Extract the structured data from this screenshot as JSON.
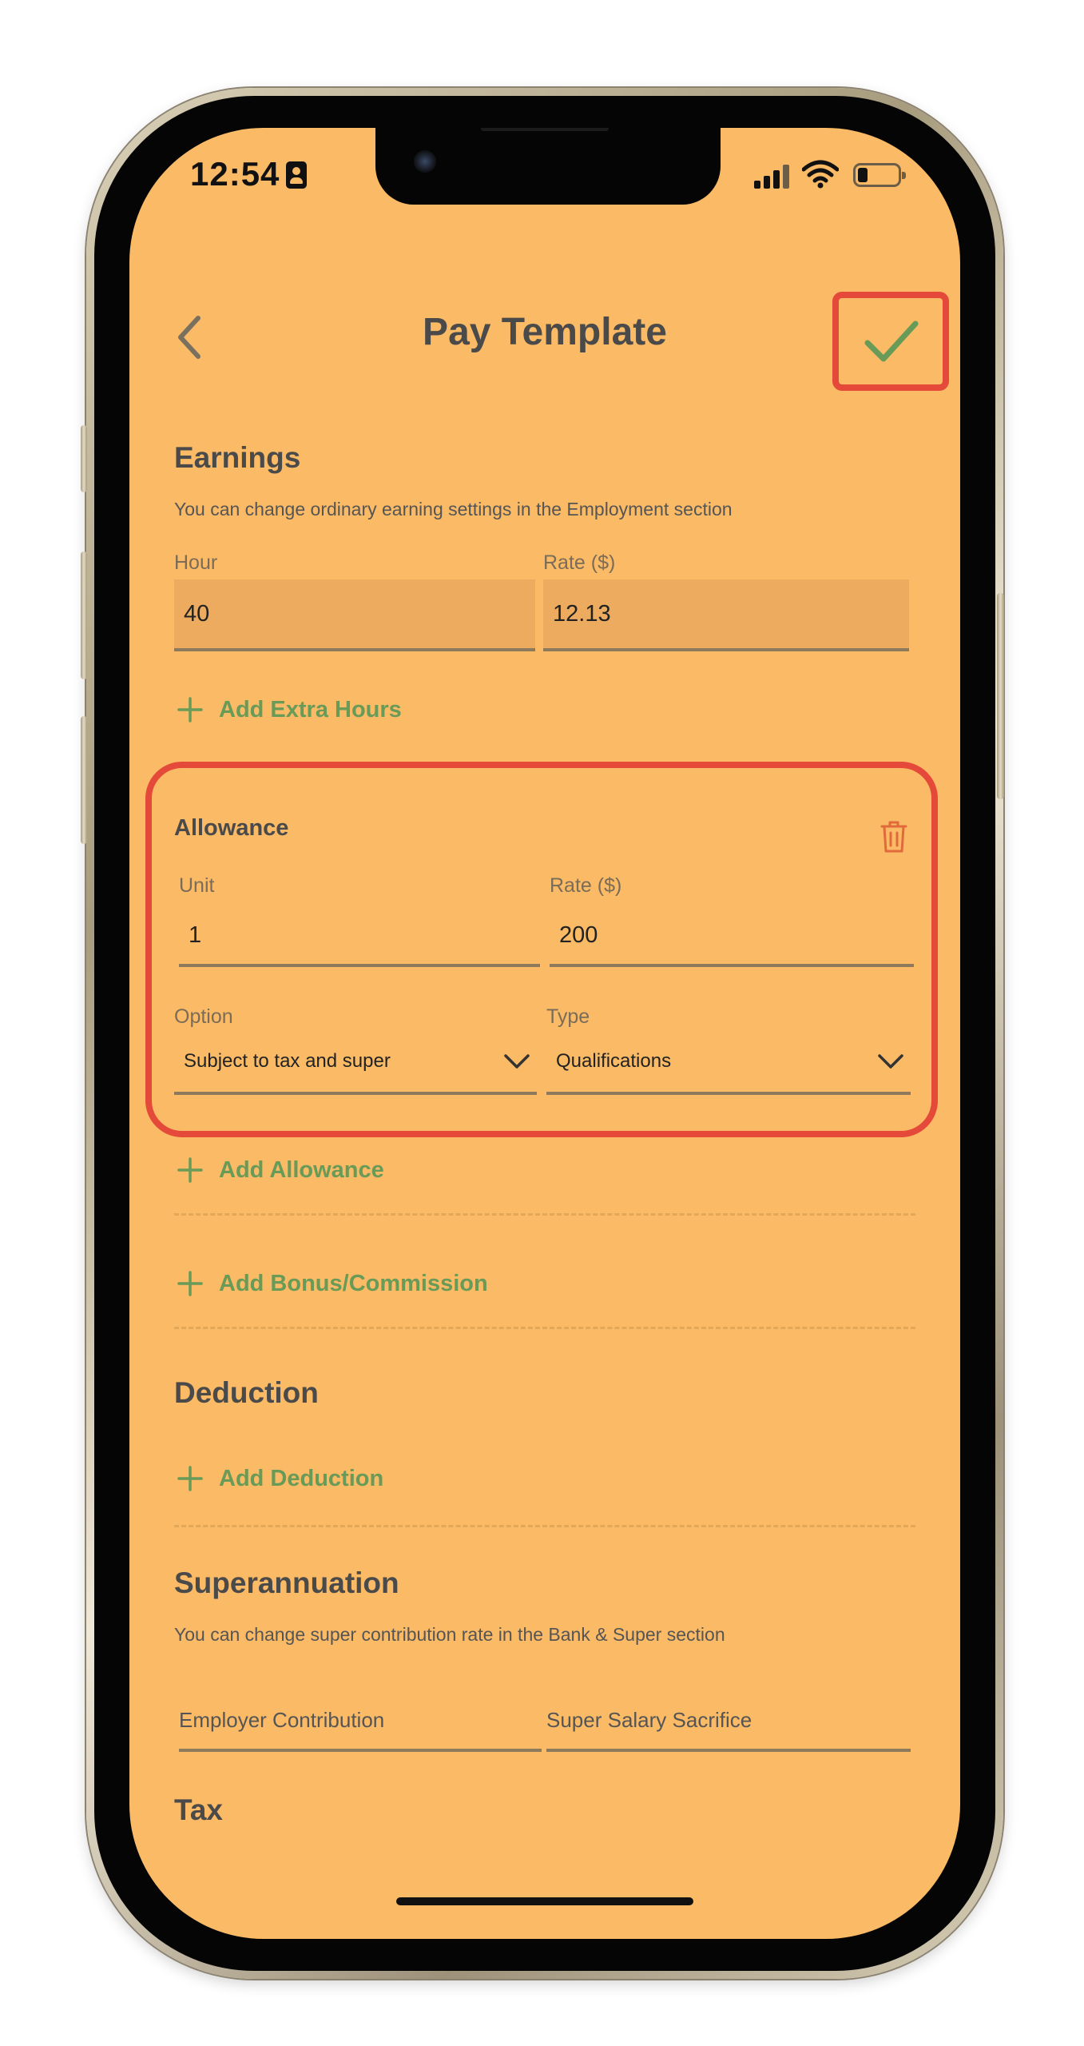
{
  "status_bar": {
    "time": "12:54"
  },
  "nav": {
    "title": "Pay Template"
  },
  "earnings": {
    "title": "Earnings",
    "hint": "You can change ordinary earning settings in the Employment section",
    "hour_label": "Hour",
    "hour_value": "40",
    "rate_label": "Rate ($)",
    "rate_value": "12.13",
    "add_extra_hours": "Add Extra Hours"
  },
  "allowance": {
    "title": "Allowance",
    "unit_label": "Unit",
    "unit_value": "1",
    "rate_label": "Rate ($)",
    "rate_value": "200",
    "option_label": "Option",
    "option_value": "Subject to tax and super",
    "type_label": "Type",
    "type_value": "Qualifications",
    "add_allowance": "Add Allowance"
  },
  "bonus": {
    "add_bonus": "Add Bonus/Commission"
  },
  "deduction": {
    "title": "Deduction",
    "add_deduction": "Add Deduction"
  },
  "superannuation": {
    "title": "Superannuation",
    "hint": "You can change super contribution rate in the Bank & Super section",
    "employer_placeholder": "Employer Contribution",
    "sacrifice_placeholder": "Super Salary Sacrifice"
  },
  "tax": {
    "title": "Tax"
  },
  "colors": {
    "background": "#fbba65",
    "accent_green": "#689a58",
    "highlight_red": "#e4493a",
    "filled_field": "#ecab5f"
  }
}
